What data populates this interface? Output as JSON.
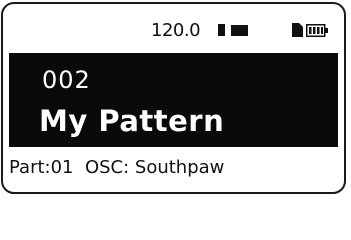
{
  "status": {
    "tempo": "120.0",
    "tempo_indicator_icon": "tempo-marker",
    "transport_icon": "transport-block",
    "file_icon": "file-icon",
    "battery_icon": "battery-icon"
  },
  "pattern": {
    "number": "002",
    "name": "My Pattern"
  },
  "part": {
    "line": "Part:01  OSC: Southpaw"
  },
  "colors": {
    "background": "#ffffff",
    "panel": "#0a0a0a",
    "text": "#111111",
    "panel_text": "#ffffff"
  }
}
